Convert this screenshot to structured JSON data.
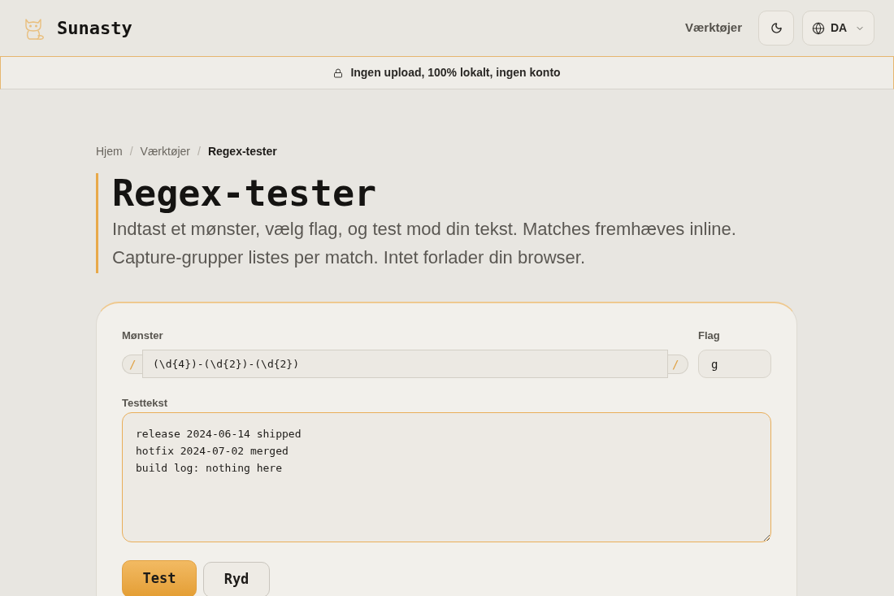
{
  "header": {
    "brand": "Sunasty",
    "nav_link": "Værktøjer",
    "language": "DA"
  },
  "banner": {
    "text": "Ingen upload, 100% lokalt, ingen konto"
  },
  "breadcrumb": {
    "separator": "/",
    "items": [
      {
        "label": "Hjem",
        "current": false
      },
      {
        "label": "Værktøjer",
        "current": false
      },
      {
        "label": "Regex-tester",
        "current": true
      }
    ]
  },
  "page": {
    "title": "Regex-tester",
    "description": "Indtast et mønster, vælg flag, og test mod din tekst. Matches fremhæves inline. Capture-grupper listes per match. Intet forlader din browser."
  },
  "form": {
    "pattern": {
      "label": "Mønster",
      "delimiter_left": "/",
      "value": "(\\d{4})-(\\d{2})-(\\d{2})",
      "delimiter_right": "/"
    },
    "flags": {
      "label": "Flag",
      "value": "g"
    },
    "test_text": {
      "label": "Testtekst",
      "value": "release 2024-06-14 shipped\nhotfix 2024-07-02 merged\nbuild log: nothing here",
      "focused": true
    },
    "buttons": [
      {
        "label": "Test",
        "kind": "primary"
      },
      {
        "label": "Ryd",
        "kind": "secondary"
      }
    ]
  }
}
